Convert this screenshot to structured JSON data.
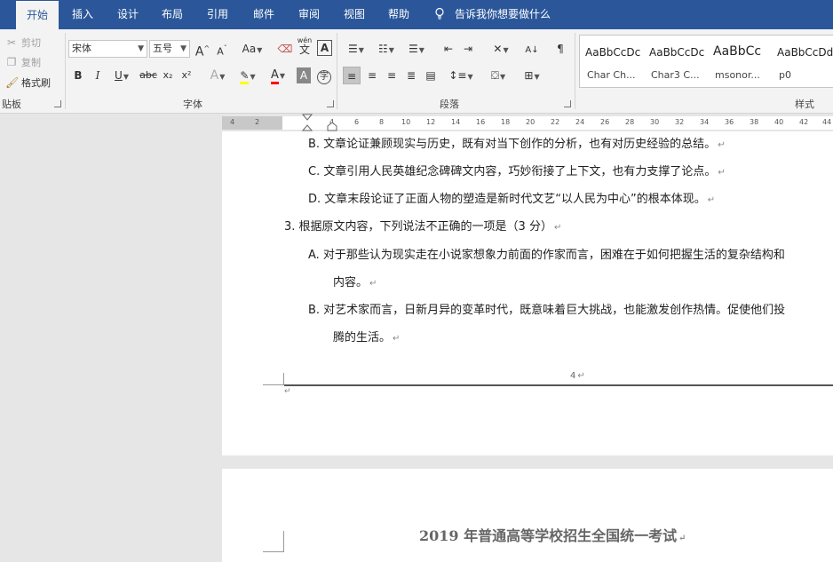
{
  "tabs": [
    {
      "label": "开始",
      "active": true
    },
    {
      "label": "插入"
    },
    {
      "label": "设计"
    },
    {
      "label": "布局"
    },
    {
      "label": "引用"
    },
    {
      "label": "邮件"
    },
    {
      "label": "审阅"
    },
    {
      "label": "视图"
    },
    {
      "label": "帮助"
    }
  ],
  "tell_me": "告诉我你想要做什么",
  "clipboard": {
    "cut": "剪切",
    "copy": "复制",
    "format_painter": "格式刷",
    "group_label": "贴板"
  },
  "font": {
    "name": "宋体",
    "size": "五号",
    "grow": "A",
    "shrink": "A",
    "case": "Aa",
    "bold": "B",
    "italic": "I",
    "underline": "U",
    "strike": "abc",
    "subscript": "x₂",
    "superscript": "x²",
    "phonetic_top": "wén",
    "phonetic_bottom": "文",
    "group_label": "字体"
  },
  "paragraph": {
    "group_label": "段落"
  },
  "styles": {
    "items": [
      {
        "sample": "AaBbCcDc",
        "name": "Char Ch..."
      },
      {
        "sample": "AaBbCcDc",
        "name": "Char3 C..."
      },
      {
        "sample": "AaBbCc",
        "name": "msonor..."
      },
      {
        "sample": "AaBbCcDd",
        "name": "p0"
      }
    ],
    "group_label": "样式"
  },
  "ruler": {
    "left_ticks": [
      "4",
      "2"
    ],
    "ticks": [
      "4",
      "6",
      "8",
      "10",
      "12",
      "14",
      "16",
      "18",
      "20",
      "22",
      "24",
      "26",
      "28",
      "30",
      "32",
      "34",
      "36",
      "38",
      "40",
      "42",
      "44"
    ]
  },
  "document": {
    "lines": [
      "B.  文章论证兼顾现实与历史，既有对当下创作的分析，也有对历史经验的总结。",
      "C. 文章引用人民英雄纪念碑碑文内容，巧妙衔接了上下文，也有力支撑了论点。",
      "D.  文章末段论证了正面人物的塑造是新时代文艺“以人民为中心”的根本体现。",
      "3. 根据原文内容，下列说法不正确的一项是（3 分）",
      "A.  对于那些认为现实走在小说家想象力前面的作家而言，困难在于如何把握生活的复杂结构和",
      "内容。",
      "B.  对艺术家而言，日新月异的变革时代，既意味着巨大挑战，也能激发创作热情。促使他们投",
      "腾的生活。"
    ],
    "page_number": "4",
    "exam_title": "2019 年普通高等学校招生全国统一考试"
  },
  "colors": {
    "tab_bar": "#2b579a",
    "highlight": "#ffff00",
    "font_color": "#ff0000"
  }
}
